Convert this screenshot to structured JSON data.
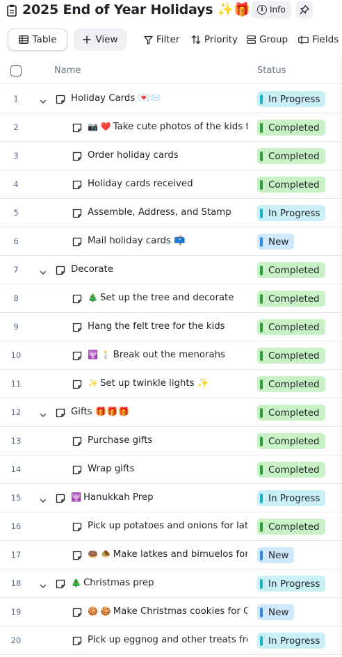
{
  "header": {
    "title": "2025 End of Year Holidays ✨🎁👯",
    "info_label": "Info"
  },
  "toolbar": {
    "table_label": "Table",
    "view_label": "View",
    "filter_label": "Filter",
    "priority_label": "Priority",
    "group_label": "Group",
    "fields_label": "Fields"
  },
  "columns": {
    "name": "Name",
    "status": "Status"
  },
  "status_colors": {
    "Completed": "#2e9c3a",
    "In Progress": "#1bb0c6",
    "New": "#2f8ae0"
  },
  "rows": [
    {
      "num": "1",
      "level": "parent",
      "expanded": true,
      "emoji": "",
      "text": "Holiday Cards 💌📨",
      "status": "In Progress"
    },
    {
      "num": "2",
      "level": "child",
      "emoji": "📷 ❤️",
      "text": "Take cute photos of the kids fo",
      "status": "Completed"
    },
    {
      "num": "3",
      "level": "child",
      "emoji": "",
      "text": "Order holiday cards",
      "status": "Completed"
    },
    {
      "num": "4",
      "level": "child",
      "emoji": "",
      "text": "Holiday cards received",
      "status": "Completed"
    },
    {
      "num": "5",
      "level": "child",
      "emoji": "",
      "text": "Assemble, Address, and Stamp",
      "status": "In Progress"
    },
    {
      "num": "6",
      "level": "child",
      "emoji": "",
      "text": "Mail holiday cards 📫",
      "status": "New"
    },
    {
      "num": "7",
      "level": "parent",
      "expanded": true,
      "emoji": "",
      "text": "Decorate",
      "status": "Completed"
    },
    {
      "num": "8",
      "level": "child",
      "emoji": "🎄",
      "text": "Set up the tree and decorate",
      "status": "Completed"
    },
    {
      "num": "9",
      "level": "child",
      "emoji": "",
      "text": "Hang the felt tree for the kids",
      "status": "Completed"
    },
    {
      "num": "10",
      "level": "child",
      "emoji": "🕎 🕯️",
      "text": "Break out the menorahs",
      "status": "Completed"
    },
    {
      "num": "11",
      "level": "child",
      "emoji": "✨",
      "text": "Set up twinkle lights ✨",
      "status": "Completed"
    },
    {
      "num": "12",
      "level": "parent",
      "expanded": true,
      "emoji": "",
      "text": "Gifts 🎁🎁🎁",
      "status": "Completed"
    },
    {
      "num": "13",
      "level": "child",
      "emoji": "",
      "text": "Purchase gifts",
      "status": "Completed"
    },
    {
      "num": "14",
      "level": "child",
      "emoji": "",
      "text": "Wrap gifts",
      "status": "Completed"
    },
    {
      "num": "15",
      "level": "parent",
      "expanded": true,
      "emoji": "🕎",
      "text": "Hanukkah Prep",
      "status": "In Progress"
    },
    {
      "num": "16",
      "level": "child",
      "emoji": "",
      "text": "Pick up potatoes and onions for latke",
      "status": "Completed"
    },
    {
      "num": "17",
      "level": "child",
      "emoji": "🍩 🧆",
      "text": "Make latkes and bimuelos for r",
      "status": "New"
    },
    {
      "num": "18",
      "level": "parent",
      "expanded": true,
      "emoji": "🎄",
      "text": "Christmas prep",
      "status": "In Progress"
    },
    {
      "num": "19",
      "level": "child",
      "emoji": "🍪 🍪",
      "text": "Make Christmas cookies for Ch",
      "status": "New"
    },
    {
      "num": "20",
      "level": "child",
      "emoji": "",
      "text": "Pick up eggnog and other treats from",
      "status": "In Progress"
    }
  ]
}
